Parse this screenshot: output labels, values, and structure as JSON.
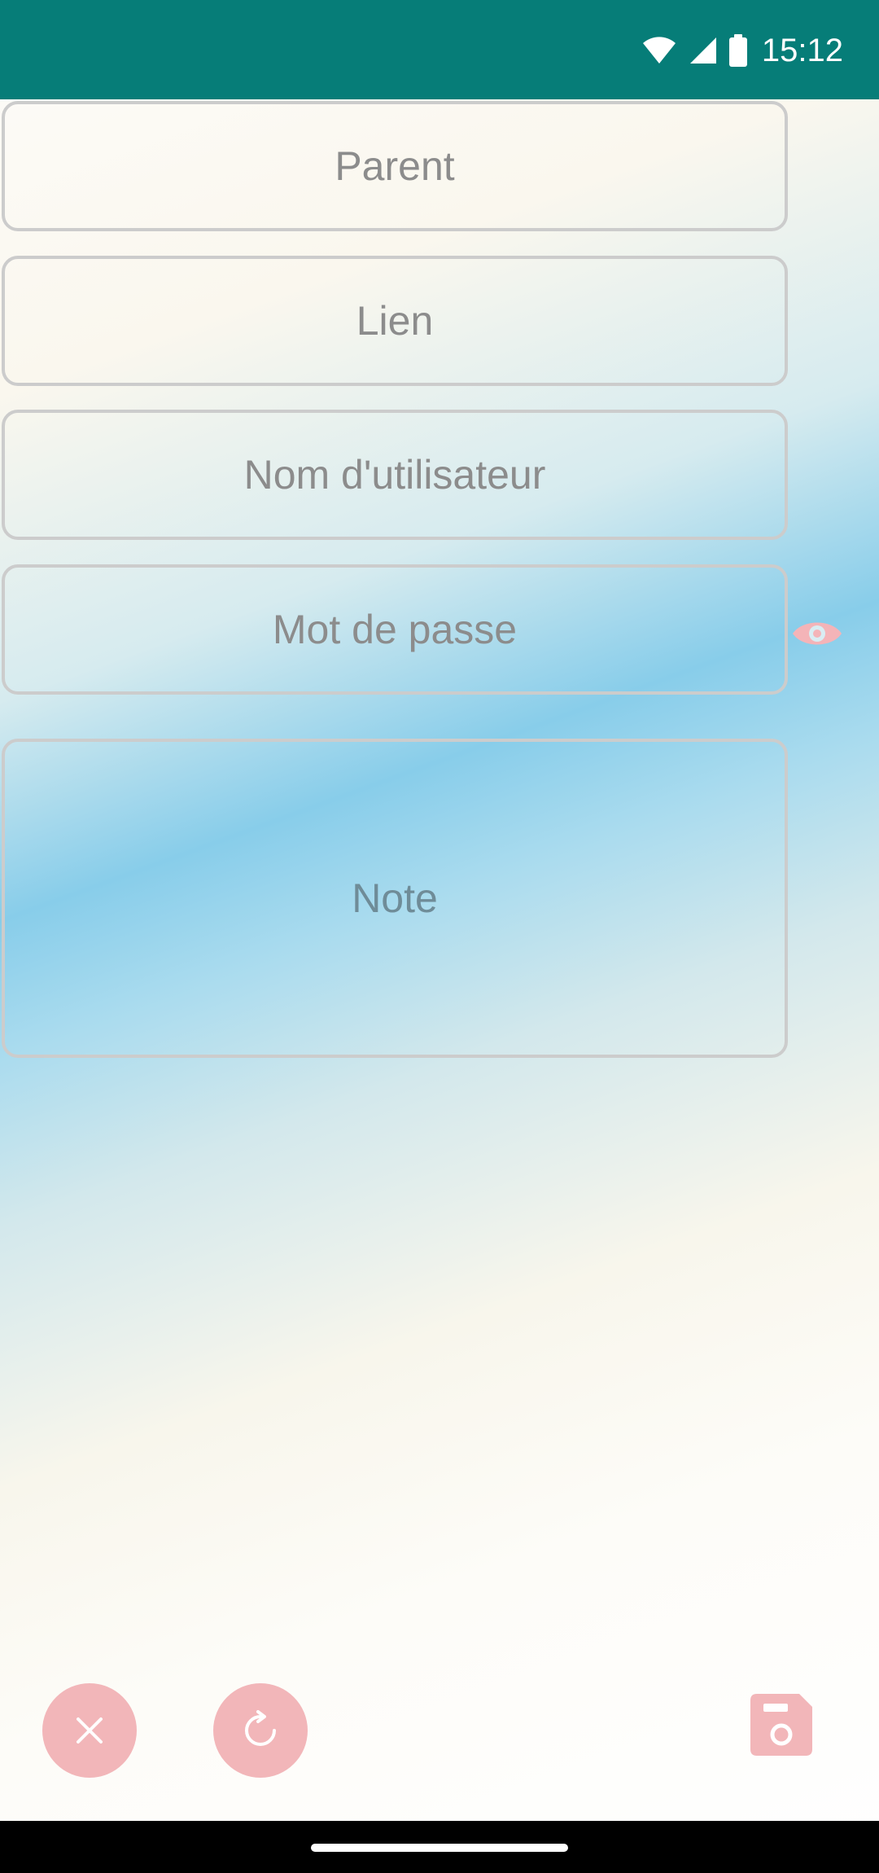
{
  "status_bar": {
    "time": "15:12",
    "icons": [
      "wifi-icon",
      "signal-icon",
      "battery-icon"
    ],
    "background": "#067d78"
  },
  "form": {
    "parent_placeholder": "Parent",
    "link_placeholder": "Lien",
    "username_placeholder": "Nom d'utilisateur",
    "password_placeholder": "Mot de passe",
    "note_placeholder": "Note"
  },
  "actions": {
    "cancel_icon": "close-icon",
    "refresh_icon": "refresh-icon",
    "save_icon": "save-icon",
    "show_password_icon": "eye-icon",
    "accent": "#f2b6b9"
  }
}
